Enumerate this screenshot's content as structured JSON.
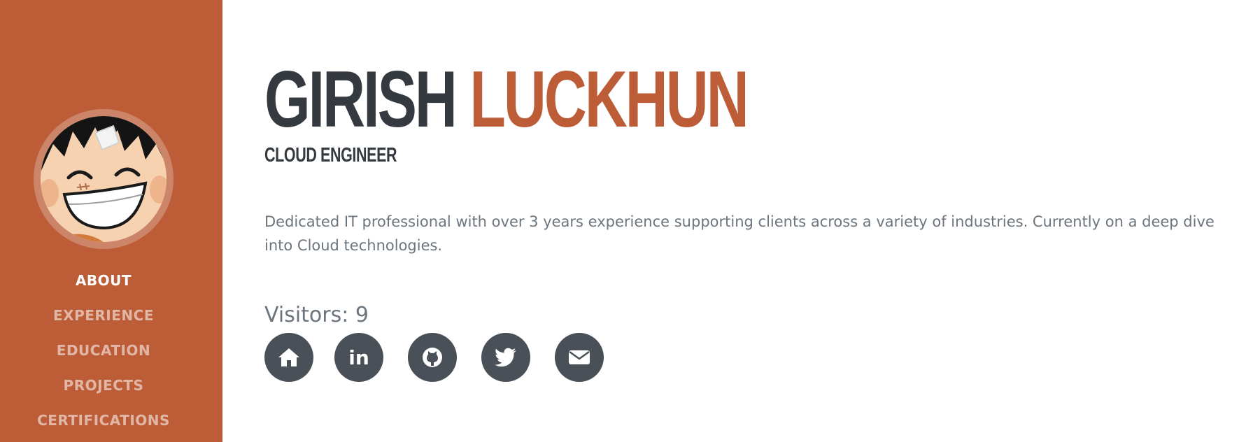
{
  "profile": {
    "first_name": "GIRISH",
    "last_name": "LUCKHUN",
    "role": "CLOUD ENGINEER",
    "bio": "Dedicated IT professional with over 3 years experience supporting clients across a variety of industries. Currently on a deep dive into Cloud technologies.",
    "visitors_label": "Visitors: 9"
  },
  "nav": {
    "items": [
      {
        "label": "ABOUT",
        "active": true
      },
      {
        "label": "EXPERIENCE",
        "active": false
      },
      {
        "label": "EDUCATION",
        "active": false
      },
      {
        "label": "PROJECTS",
        "active": false
      },
      {
        "label": "CERTIFICATIONS",
        "active": false
      }
    ]
  },
  "social": {
    "icons": [
      "home-icon",
      "linkedin-icon",
      "github-icon",
      "twitter-icon",
      "envelope-icon"
    ],
    "linkedin_text": "in"
  },
  "colors": {
    "accent": "#bd5d38",
    "heading": "#343a40",
    "muted_text": "#6c757d",
    "social_button": "#495057"
  }
}
